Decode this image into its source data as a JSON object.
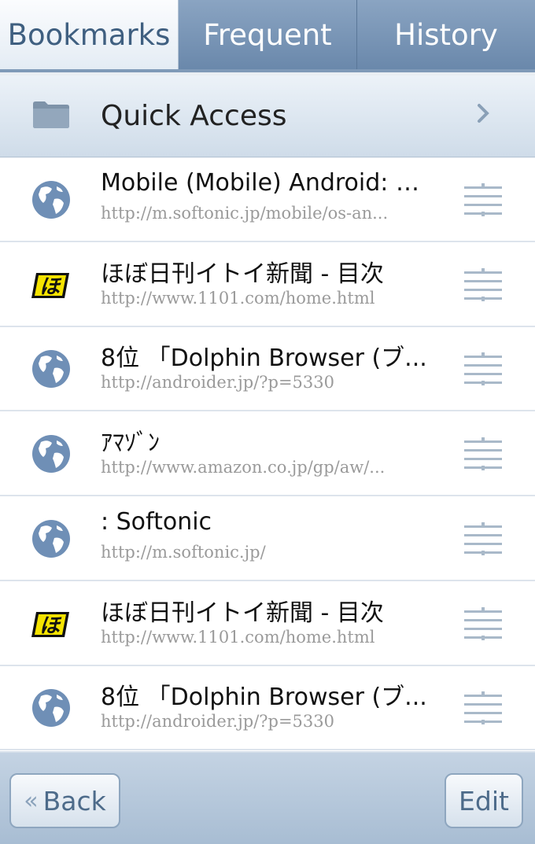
{
  "tabs": [
    {
      "label": "Bookmarks",
      "active": true
    },
    {
      "label": "Frequent",
      "active": false
    },
    {
      "label": "History",
      "active": false
    }
  ],
  "quick_access": {
    "label": "Quick Access",
    "icon": "folder-icon"
  },
  "bookmarks": [
    {
      "title": "Mobile (Mobile) Android: S...",
      "url": "http://m.softonic.jp/mobile/os-an...",
      "icon": "globe-icon"
    },
    {
      "title": "ほぼ日刊イトイ新聞 - 目次",
      "url": "http://www.1101.com/home.html",
      "icon": "hobonichi-icon"
    },
    {
      "title": "8位 「Dolphin Browser (ブ...",
      "url": "http://androider.jp/?p=5330",
      "icon": "globe-icon"
    },
    {
      "title": "ｱﾏｿﾞﾝ",
      "url": "http://www.amazon.co.jp/gp/aw/...",
      "icon": "globe-icon"
    },
    {
      "title": ": Softonic",
      "url": "http://m.softonic.jp/",
      "icon": "globe-icon"
    },
    {
      "title": "ほぼ日刊イトイ新聞 - 目次",
      "url": "http://www.1101.com/home.html",
      "icon": "hobonichi-icon"
    },
    {
      "title": "8位 「Dolphin Browser (ブ...",
      "url": "http://androider.jp/?p=5330",
      "icon": "globe-icon"
    }
  ],
  "footer": {
    "back_label": "Back",
    "edit_label": "Edit"
  },
  "colors": {
    "tab_inactive": "#7c97b8",
    "tab_active_text": "#3f5f80",
    "url_gray": "#9a9a9a",
    "globe_blue": "#6f8fb6",
    "hobonichi_yellow": "#f5e300"
  }
}
